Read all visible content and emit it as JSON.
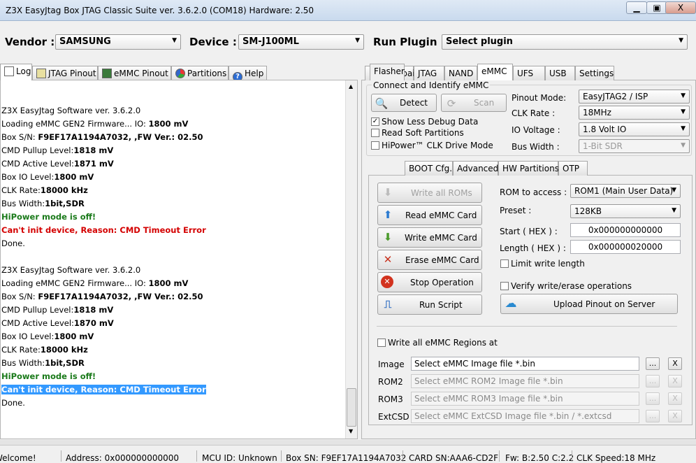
{
  "window": {
    "title": "Z3X EasyJtag Box JTAG Classic Suite ver. 3.6.2.0 (COM18) Hardware: 2.50",
    "min": "▭",
    "max": "▣",
    "close": "X"
  },
  "toolbar": {
    "vendor_label": "Vendor :",
    "vendor_value": "SAMSUNG",
    "device_label": "Device :",
    "device_value": "SM-J100ML",
    "plugin_label": "Run Plugin :",
    "plugin_value": "Select plugin"
  },
  "left_tabs": [
    "Log",
    "JTAG Pinout",
    "eMMC Pinout",
    "Partitions",
    "Help"
  ],
  "log": [
    {
      "t": "Z3X EasyJtag Software ver. 3.6.2.0",
      "b": ""
    },
    {
      "t": "Loading eMMC GEN2 Firmware... IO: ",
      "b": "1800 mV"
    },
    {
      "t": "Box S/N: ",
      "b": "F9EF17A1194A7032, ,FW Ver.: 02.50"
    },
    {
      "t": "CMD Pullup Level:",
      "b": "1818 mV"
    },
    {
      "t": "CMD Active Level:",
      "b": "1871 mV"
    },
    {
      "t": "Box IO Level:",
      "b": "1800 mV"
    },
    {
      "t": "CLK Rate:",
      "b": "18000 kHz"
    },
    {
      "t": "Bus Width:",
      "b": "1bit,SDR"
    },
    {
      "green": "HiPower mode is off!"
    },
    {
      "red": "Can't init device, Reason: CMD Timeout Error"
    },
    {
      "t": "Done.",
      "b": ""
    },
    {
      "t": "",
      "b": ""
    },
    {
      "t": "Z3X EasyJtag Software ver. 3.6.2.0",
      "b": ""
    },
    {
      "t": "Loading eMMC GEN2 Firmware... IO: ",
      "b": "1800 mV"
    },
    {
      "t": "Box S/N: ",
      "b": "F9EF17A1194A7032, ,FW Ver.: 02.50"
    },
    {
      "t": "CMD Pullup Level:",
      "b": "1818 mV"
    },
    {
      "t": "CMD Active Level:",
      "b": "1870 mV"
    },
    {
      "t": "Box IO Level:",
      "b": "1800 mV"
    },
    {
      "t": "CLK Rate:",
      "b": "18000 kHz"
    },
    {
      "t": "Bus Width:",
      "b": "1bit,SDR"
    },
    {
      "green": "HiPower mode is off!"
    },
    {
      "sel": "Can't init device, Reason: CMD Timeout Error"
    },
    {
      "t": "Done.",
      "b": ""
    }
  ],
  "right_tabs": [
    "Easy Repair",
    "JTAG",
    "NAND",
    "eMMC",
    "UFS",
    "USB",
    "Settings"
  ],
  "connect": {
    "group": "Connect and Identify eMMC",
    "detect": "Detect",
    "scan": "Scan",
    "chk_less_debug": "Show Less Debug Data",
    "chk_soft_part": "Read Soft Partitions",
    "chk_hipower": "HiPower™ CLK Drive Mode",
    "pinout_label": "Pinout Mode:",
    "pinout_value": "EasyJTAG2 / ISP",
    "clk_label": "CLK Rate :",
    "clk_value": "18MHz",
    "io_label": "IO Voltage :",
    "io_value": "1.8 Volt IO",
    "bus_label": "Bus Width :",
    "bus_value": "1-Bit SDR"
  },
  "sub_tabs": [
    "Flasher",
    "BOOT Cfg.",
    "Advanced",
    "HW Partitions",
    "OTP"
  ],
  "flasher": {
    "write_all": "Write all ROMs",
    "read": "Read eMMC Card",
    "write": "Write eMMC Card",
    "erase": "Erase eMMC Card",
    "stop": "Stop Operation",
    "script": "Run Script",
    "rom_label": "ROM to access :",
    "rom_value": "ROM1 (Main User Data)",
    "preset_label": "Preset :",
    "preset_value": "128KB",
    "start_label": "Start ( HEX ) :",
    "start_value": "0x000000000000",
    "length_label": "Length ( HEX ) :",
    "length_value": "0x000000020000",
    "limit": "Limit write length",
    "verify": "Verify write/erase operations",
    "upload": "Upload Pinout on Server",
    "write_regions": "Write all eMMC Regions at onc",
    "files": [
      {
        "label": "Image",
        "value": "Select eMMC Image file *.bin"
      },
      {
        "label": "ROM2",
        "value": "Select eMMC ROM2 Image file *.bin"
      },
      {
        "label": "ROM3",
        "value": "Select eMMC ROM3 Image file *.bin"
      },
      {
        "label": "ExtCSD",
        "value": "Select eMMC ExtCSD Image file *.bin / *.extcsd"
      }
    ],
    "dots": "...",
    "x": "X"
  },
  "status": {
    "welcome": "Welcome!",
    "address": "Address: 0x000000000000",
    "mcu": "MCU ID: Unknown",
    "box": "Box SN: F9EF17A1194A7032",
    "card": "CARD SN:AAA6-CD2F",
    "fw": "Fw: B:2.50 C:2.2",
    "clk": "CLK Speed:18 MHz"
  },
  "colors": {
    "green": "#1a7a1a",
    "red": "#d40000",
    "selection": "#3399ff"
  }
}
